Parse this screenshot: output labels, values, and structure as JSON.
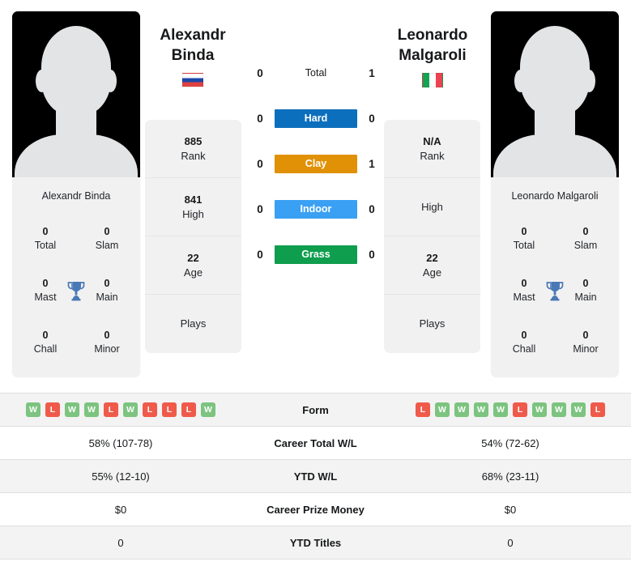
{
  "players": {
    "left": {
      "first_name": "Alexandr",
      "last_name": "Binda",
      "full_name": "Alexandr Binda",
      "flag": "russia-flag",
      "rank": "885",
      "rank_label": "Rank",
      "high": "841",
      "high_label": "High",
      "age": "22",
      "age_label": "Age",
      "plays": "",
      "plays_label": "Plays",
      "titles": {
        "total": "0",
        "total_label": "Total",
        "slam": "0",
        "slam_label": "Slam",
        "mast": "0",
        "mast_label": "Mast",
        "main": "0",
        "main_label": "Main",
        "chall": "0",
        "chall_label": "Chall",
        "minor": "0",
        "minor_label": "Minor"
      },
      "form": [
        "W",
        "L",
        "W",
        "W",
        "L",
        "W",
        "L",
        "L",
        "L",
        "W"
      ],
      "career_wl": "58% (107-78)",
      "ytd_wl": "55% (12-10)",
      "career_prize_money": "$0",
      "ytd_titles": "0"
    },
    "right": {
      "first_name": "Leonardo",
      "last_name": "Malgaroli",
      "full_name": "Leonardo Malgaroli",
      "flag": "italy-flag",
      "rank": "N/A",
      "rank_label": "Rank",
      "high": "",
      "high_label": "High",
      "age": "22",
      "age_label": "Age",
      "plays": "",
      "plays_label": "Plays",
      "titles": {
        "total": "0",
        "total_label": "Total",
        "slam": "0",
        "slam_label": "Slam",
        "mast": "0",
        "mast_label": "Mast",
        "main": "0",
        "main_label": "Main",
        "chall": "0",
        "chall_label": "Chall",
        "minor": "0",
        "minor_label": "Minor"
      },
      "form": [
        "L",
        "W",
        "W",
        "W",
        "W",
        "L",
        "W",
        "W",
        "W",
        "L"
      ],
      "career_wl": "54% (72-62)",
      "ytd_wl": "68% (23-11)",
      "career_prize_money": "$0",
      "ytd_titles": "0"
    }
  },
  "head_to_head": {
    "surfaces": [
      {
        "label": "Total",
        "left": "0",
        "right": "1",
        "color": ""
      },
      {
        "label": "Hard",
        "left": "0",
        "right": "0",
        "color": "#0c6fbd"
      },
      {
        "label": "Clay",
        "left": "0",
        "right": "1",
        "color": "#e09106"
      },
      {
        "label": "Indoor",
        "left": "0",
        "right": "0",
        "color": "#3aa0f3"
      },
      {
        "label": "Grass",
        "left": "0",
        "right": "0",
        "color": "#0e9e4e"
      }
    ]
  },
  "comparison_rows": [
    {
      "label": "Form",
      "left": "",
      "right": "",
      "type": "form"
    },
    {
      "label": "Career Total W/L",
      "left": "58% (107-78)",
      "right": "54% (72-62)",
      "type": "text"
    },
    {
      "label": "YTD W/L",
      "left": "55% (12-10)",
      "right": "68% (23-11)",
      "type": "text"
    },
    {
      "label": "Career Prize Money",
      "left": "$0",
      "right": "$0",
      "type": "text"
    },
    {
      "label": "YTD Titles",
      "left": "0",
      "right": "0",
      "type": "text"
    }
  ],
  "colors": {
    "hard": "#0c6fbd",
    "clay": "#e09106",
    "indoor": "#3aa0f3",
    "grass": "#0e9e4e",
    "win": "#7cc47f",
    "loss": "#ef5a4a",
    "trophy": "#4a78b5",
    "panel": "#f1f1f1"
  }
}
